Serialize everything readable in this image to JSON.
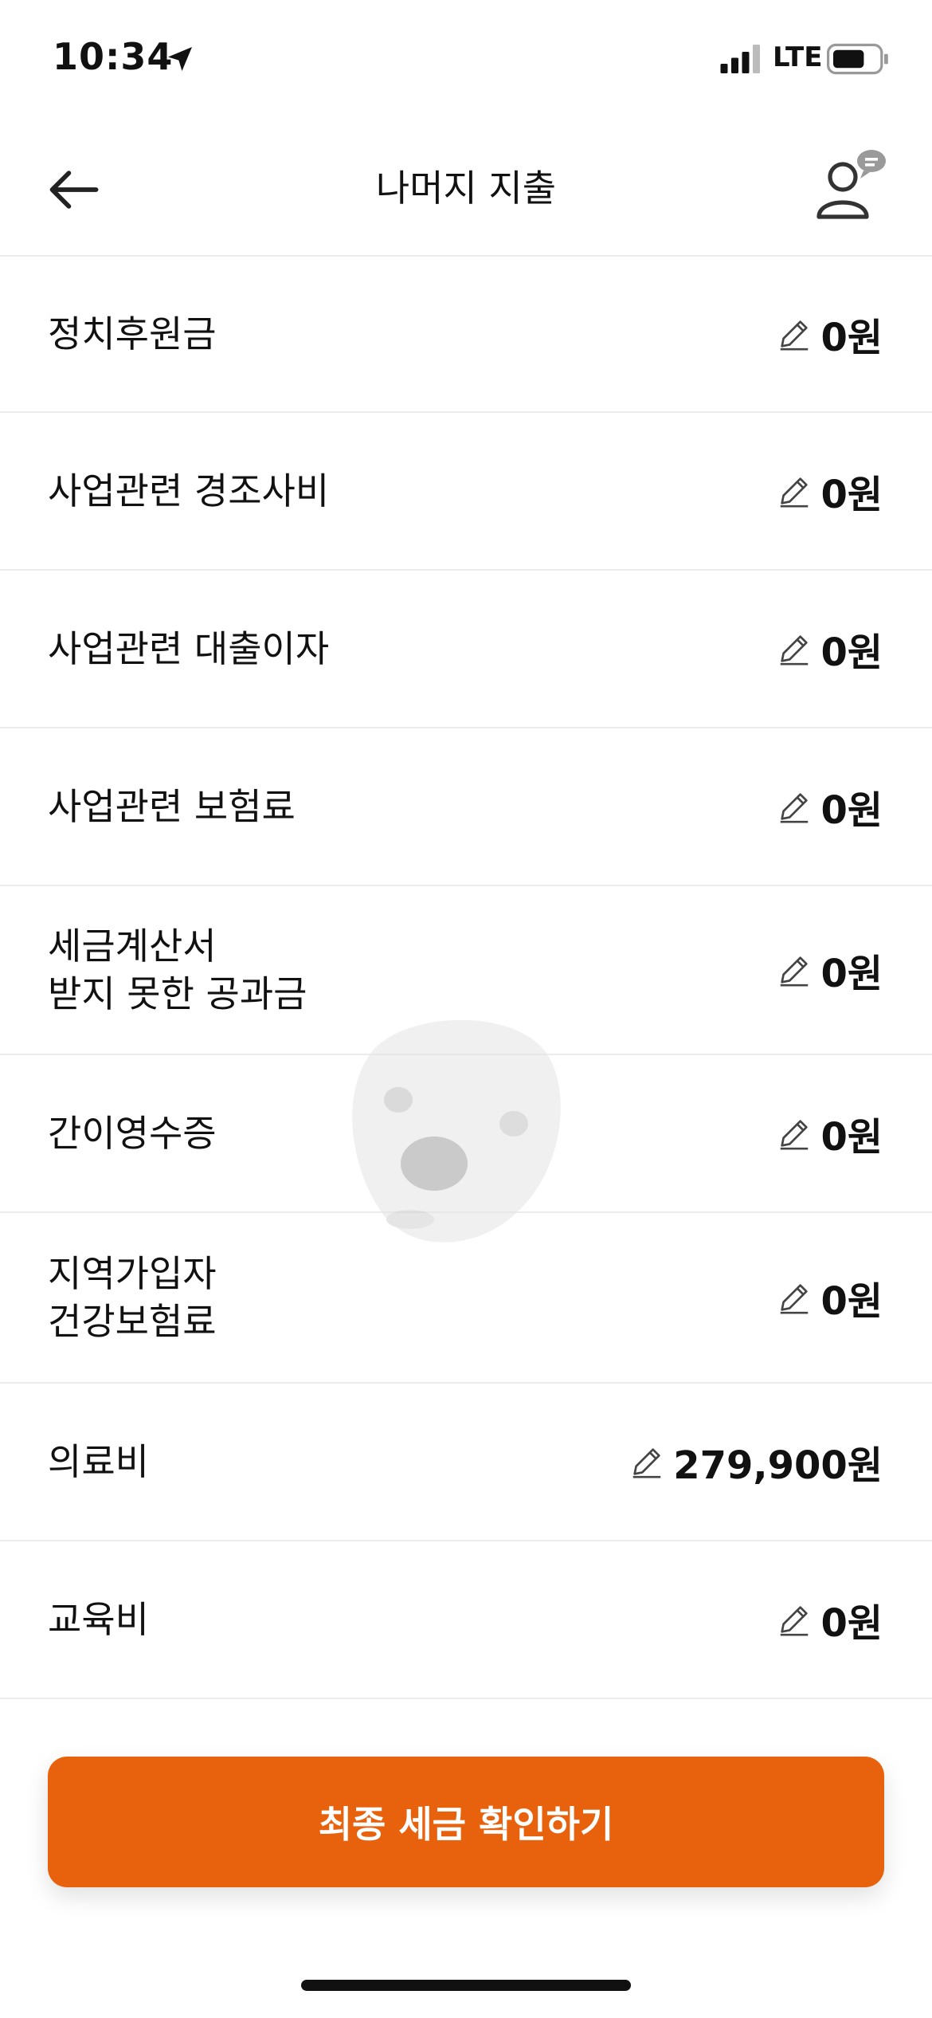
{
  "status_bar": {
    "time": "10:34",
    "network": "LTE",
    "icons": [
      "location-arrow-icon",
      "signal-icon",
      "battery-icon"
    ]
  },
  "header": {
    "title": "나머지 지출",
    "back_icon": "arrow-left-icon",
    "profile_icon": "user-chat-icon"
  },
  "rows": [
    {
      "label": "정치후원금",
      "value": "0원"
    },
    {
      "label": "사업관련 경조사비",
      "value": "0원"
    },
    {
      "label": "사업관련 대출이자",
      "value": "0원"
    },
    {
      "label": "사업관련 보험료",
      "value": "0원"
    },
    {
      "label": "세금계산서\n받지 못한 공과금",
      "value": "0원"
    },
    {
      "label": "간이영수증",
      "value": "0원"
    },
    {
      "label": "지역가입자\n건강보험료",
      "value": "0원"
    },
    {
      "label": "의료비",
      "value": "279,900원"
    },
    {
      "label": "교육비",
      "value": "0원"
    }
  ],
  "cta": {
    "label": "최종 세금 확인하기"
  },
  "colors": {
    "accent": "#e8620e",
    "divider": "#ececec",
    "text": "#111111"
  }
}
